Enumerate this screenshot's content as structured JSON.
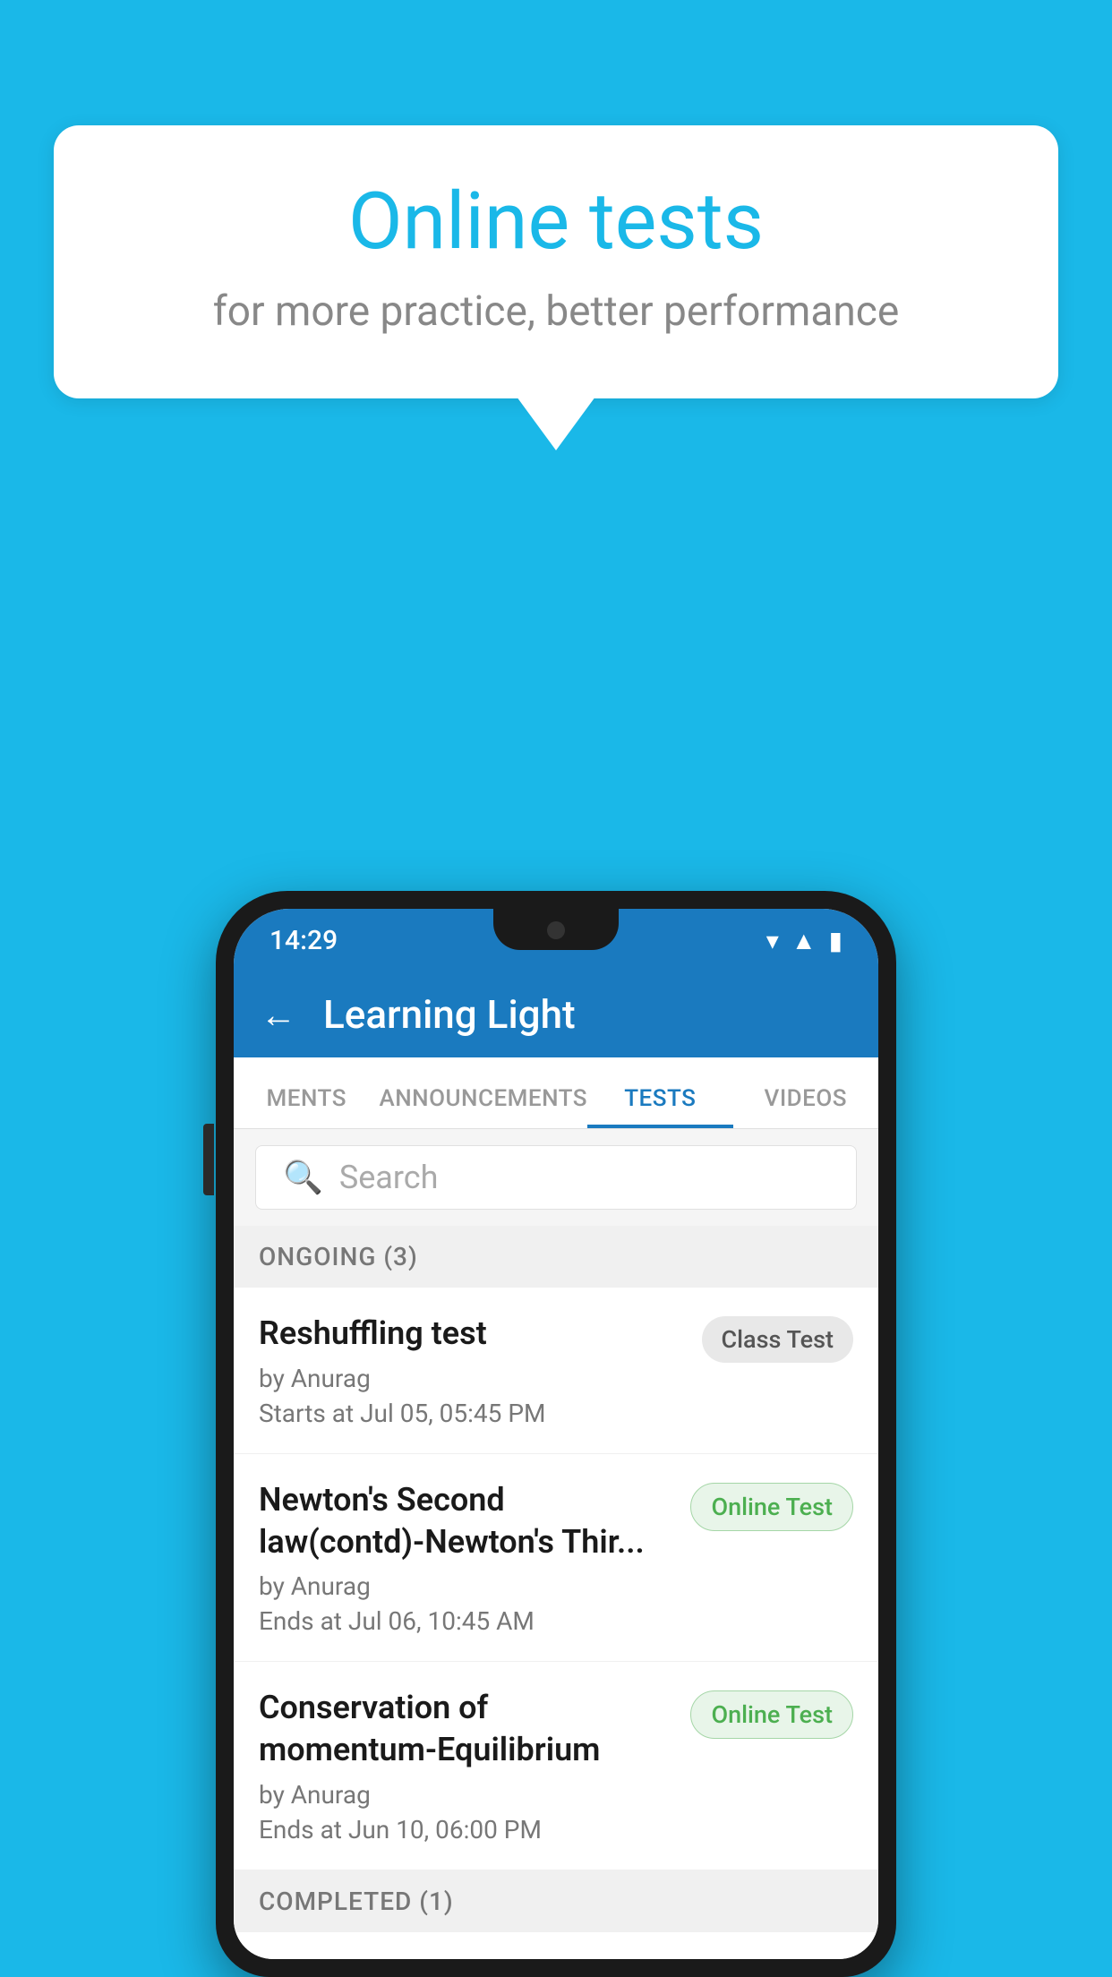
{
  "background_color": "#1ab8e8",
  "bubble": {
    "title": "Online tests",
    "subtitle": "for more practice, better performance"
  },
  "phone": {
    "status_bar": {
      "time": "14:29",
      "wifi": "▾",
      "signal": "▲",
      "battery": "▮"
    },
    "app_bar": {
      "back_label": "←",
      "title": "Learning Light"
    },
    "tabs": [
      {
        "label": "MENTS",
        "active": false
      },
      {
        "label": "ANNOUNCEMENTS",
        "active": false
      },
      {
        "label": "TESTS",
        "active": true
      },
      {
        "label": "VIDEOS",
        "active": false
      }
    ],
    "search": {
      "placeholder": "Search"
    },
    "ongoing_section": {
      "label": "ONGOING (3)"
    },
    "tests": [
      {
        "name": "Reshuffling test",
        "author": "by Anurag",
        "date": "Starts at  Jul 05, 05:45 PM",
        "badge_text": "Class Test",
        "badge_type": "gray"
      },
      {
        "name": "Newton's Second law(contd)-Newton's Thir...",
        "author": "by Anurag",
        "date": "Ends at  Jul 06, 10:45 AM",
        "badge_text": "Online Test",
        "badge_type": "green"
      },
      {
        "name": "Conservation of momentum-Equilibrium",
        "author": "by Anurag",
        "date": "Ends at  Jun 10, 06:00 PM",
        "badge_text": "Online Test",
        "badge_type": "green"
      }
    ],
    "completed_section": {
      "label": "COMPLETED (1)"
    }
  }
}
